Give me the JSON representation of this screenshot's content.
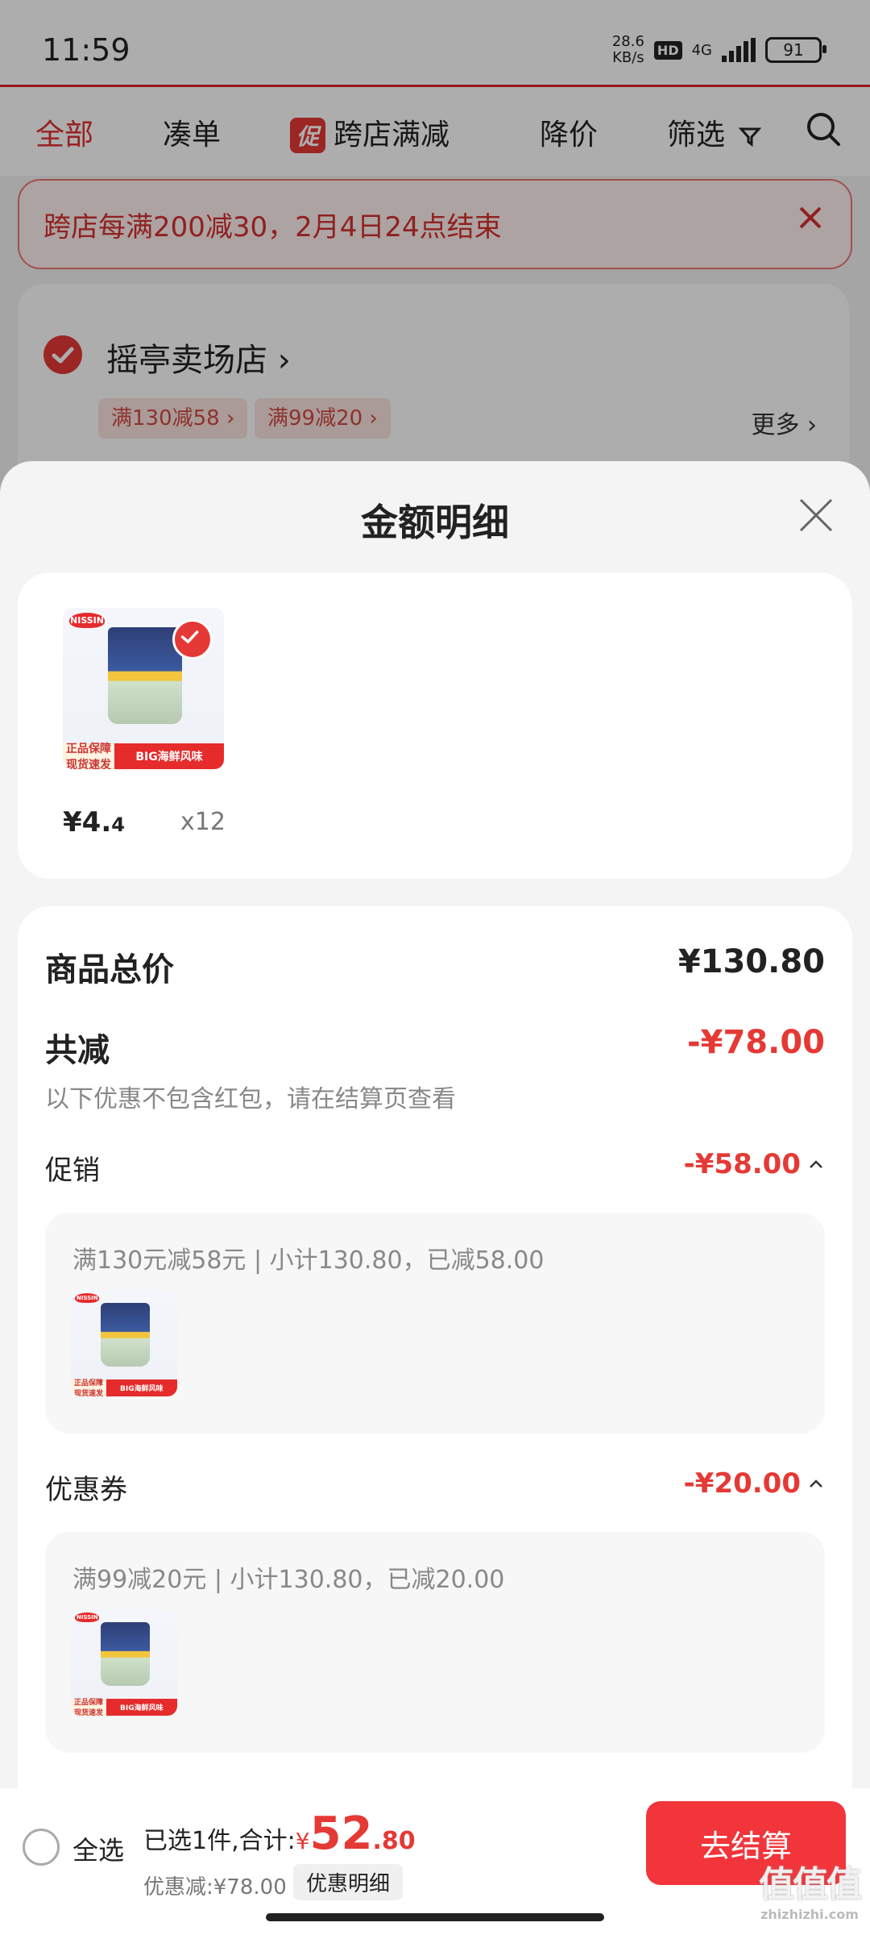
{
  "status_bar": {
    "time": "11:59",
    "net_speed_value": "28.6",
    "net_speed_unit": "KB/s",
    "hd": "HD",
    "network": "4G",
    "battery": "91"
  },
  "tabs": {
    "all": "全部",
    "bundle": "凑单",
    "promo_badge": "促",
    "cross_store": "跨店满减",
    "price_drop": "降价",
    "filter": "筛选"
  },
  "notice": {
    "text": "跨店每满200减30，2月4日24点结束"
  },
  "shop": {
    "name": "摇亭卖场店",
    "chips": [
      "满130减58",
      "满99减20"
    ],
    "more": "更多"
  },
  "sheet": {
    "title": "金额明细",
    "product": {
      "logo": "NISSIN",
      "band_left_1": "正品保障",
      "band_left_2": "现货速发",
      "band_right": "BIG海鲜风味",
      "price_int": "¥4.",
      "price_dec": "4",
      "qty": "x12"
    },
    "total_label": "商品总价",
    "total_value": "¥130.80",
    "reduce_label": "共减",
    "reduce_value": "-¥78.00",
    "reduce_note": "以下优惠不包含红包，请在结算页查看",
    "promo_label": "促销",
    "promo_value": "-¥58.00",
    "promo_detail": "满130元减58元 | 小计130.80，已减58.00",
    "coupon_label": "优惠券",
    "coupon_value": "-¥20.00",
    "coupon_detail": "满99减20元 | 小计130.80，已减20.00"
  },
  "bottom_bar": {
    "select_all": "全选",
    "selected_text": "已选1件,合计:",
    "currency": "¥",
    "total_int": "52",
    "total_dec": ".80",
    "discount_text": "优惠减:¥78.00",
    "detail_button": "优惠明细",
    "checkout_button": "去结算"
  },
  "watermark": {
    "logo": "值值值",
    "url": "zhizhizhi.com"
  },
  "colors": {
    "accent": "#e53935",
    "checkout": "#f2353b",
    "chip_bg": "#fbe3e1"
  }
}
